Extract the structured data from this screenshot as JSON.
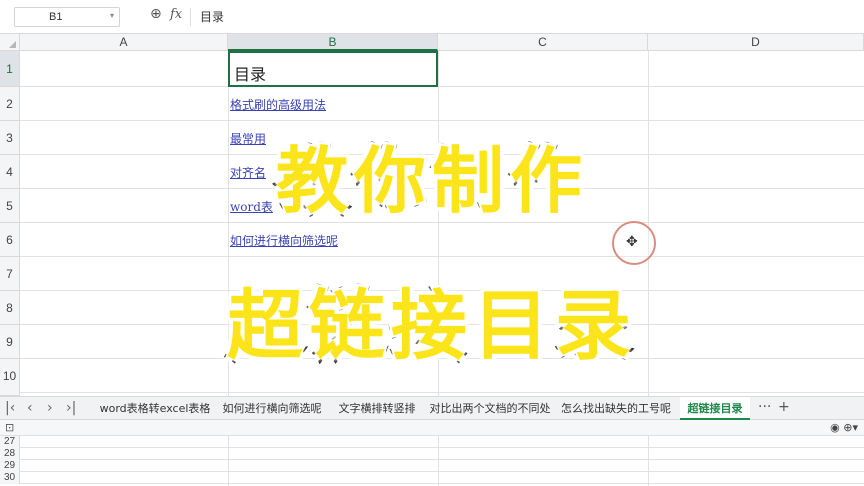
{
  "formula_bar": {
    "name_box": "B1",
    "name_box_arrow": "▾",
    "zoom_icon": "⊕",
    "fx_label": "fx",
    "content": "目录"
  },
  "columns": [
    "A",
    "B",
    "C",
    "D"
  ],
  "rows": [
    "1",
    "2",
    "3",
    "4",
    "5",
    "6",
    "7",
    "8",
    "9",
    "10"
  ],
  "cells": {
    "b1": "目录",
    "links": [
      "格式刷的高级用法",
      "最常用",
      "对齐名",
      "word表",
      "如何进行横向筛选呢"
    ]
  },
  "overlay": {
    "line1": "教你制作",
    "line2": "超链接目录"
  },
  "cursor_icon": "✥",
  "sheet_nav": [
    "|‹",
    "‹",
    "›",
    "›|"
  ],
  "sheet_tabs": [
    "word表格转excel表格",
    "如何进行横向筛选呢",
    "文字横排转竖排",
    "对比出两个文档的不同处",
    "怎么找出缺失的工号呢",
    "超链接目录"
  ],
  "active_tab": "超链接目录",
  "tab_more": "···",
  "tab_add": "+",
  "pane2": {
    "left_icon": "⊡",
    "right_icons": "◉  ⊕▾",
    "rows": [
      "27",
      "28",
      "29",
      "30"
    ]
  }
}
